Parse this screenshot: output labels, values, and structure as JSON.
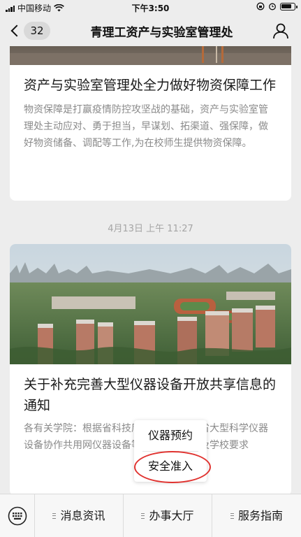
{
  "status_bar": {
    "carrier": "中国移动",
    "time": "下午3:50"
  },
  "nav": {
    "back_count": "32",
    "title": "青理工资产与实验室管理处"
  },
  "articles": [
    {
      "title": "资产与实验室管理处全力做好物资保障工作",
      "summary": "物资保障是打赢疫情防控攻坚战的基础，资产与实验室管理处主动应对、勇于担当，早谋划、拓渠道、强保障，做好物资储备、调配等工作,为在校师生提供物资保障。"
    },
    {
      "title": "关于补充完善大型仪器设备开放共享信息的通知",
      "summary": "各有关学院：根据省科技厅《关于在山东省大型科学仪器设备协作共用网仪器设备等信息的通知》及学校要求"
    }
  ],
  "time_label": "4月13日 上午 11:27",
  "popup_menu": {
    "items": [
      "仪器预约",
      "安全准入"
    ]
  },
  "bottom_menu": {
    "items": [
      "消息资讯",
      "办事大厅",
      "服务指南"
    ]
  },
  "colors": {
    "highlight_circle": "#e0322f",
    "background": "#ededed"
  }
}
